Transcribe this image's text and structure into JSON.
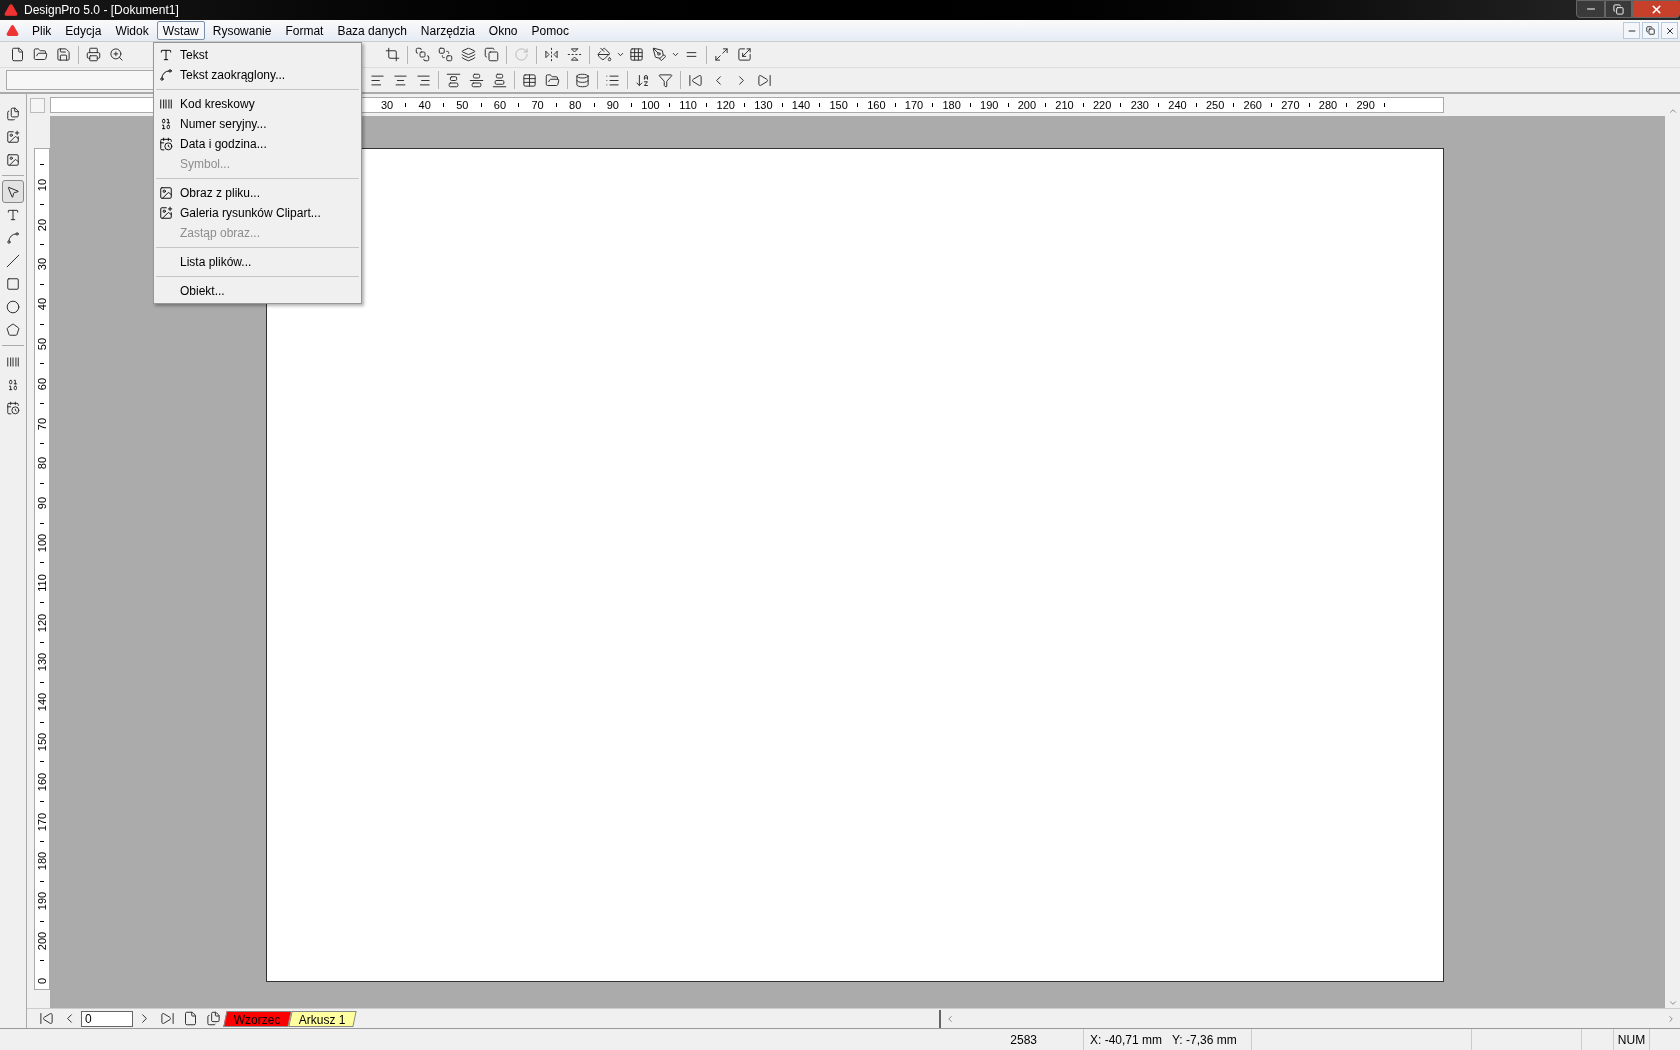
{
  "window": {
    "title": "DesignPro 5.0 - [Dokument1]"
  },
  "menu_bar": [
    {
      "label": "Plik",
      "selected": false
    },
    {
      "label": "Edycja",
      "selected": false
    },
    {
      "label": "Widok",
      "selected": false
    },
    {
      "label": "Wstaw",
      "selected": true
    },
    {
      "label": "Rysowanie",
      "selected": false
    },
    {
      "label": "Format",
      "selected": false
    },
    {
      "label": "Baza danych",
      "selected": false
    },
    {
      "label": "Narzędzia",
      "selected": false
    },
    {
      "label": "Okno",
      "selected": false
    },
    {
      "label": "Pomoc",
      "selected": false
    }
  ],
  "insert_menu": [
    {
      "kind": "text",
      "label": "Tekst",
      "disabled": false
    },
    {
      "kind": "curved",
      "label": "Tekst zaokrąglony...",
      "disabled": false
    },
    {
      "kind": "separator"
    },
    {
      "kind": "barcode",
      "label": "Kod kreskowy",
      "disabled": false
    },
    {
      "kind": "serial",
      "label": "Numer seryjny...",
      "disabled": false
    },
    {
      "kind": "datetime",
      "label": "Data i godzina...",
      "disabled": false
    },
    {
      "kind": "plain",
      "label": "Symbol...",
      "disabled": true
    },
    {
      "kind": "separator"
    },
    {
      "kind": "image",
      "label": "Obraz z pliku...",
      "disabled": false
    },
    {
      "kind": "clipart",
      "label": "Galeria rysunków Clipart...",
      "disabled": false
    },
    {
      "kind": "plain",
      "label": "Zastąp obraz...",
      "disabled": true
    },
    {
      "kind": "separator"
    },
    {
      "kind": "plain",
      "label": "Lista plików...",
      "disabled": false
    },
    {
      "kind": "separator"
    },
    {
      "kind": "plain",
      "label": "Obiekt...",
      "disabled": false
    }
  ],
  "left_tools": [
    {
      "kind": "pages",
      "selected": false
    },
    {
      "kind": "clipart",
      "selected": false
    },
    {
      "kind": "image",
      "selected": false
    },
    {
      "kind": "separator"
    },
    {
      "kind": "pointer",
      "selected": true
    },
    {
      "kind": "text",
      "selected": false
    },
    {
      "kind": "curved",
      "selected": false
    },
    {
      "kind": "line",
      "selected": false
    },
    {
      "kind": "rect",
      "selected": false
    },
    {
      "kind": "ellipse",
      "selected": false
    },
    {
      "kind": "polygon",
      "selected": false
    },
    {
      "kind": "separator"
    },
    {
      "kind": "barcode",
      "selected": false
    },
    {
      "kind": "serial",
      "selected": false
    },
    {
      "kind": "datetime",
      "selected": false
    }
  ],
  "ruler_h": [
    "30",
    "40",
    "50",
    "60",
    "70",
    "80",
    "90",
    "100",
    "110",
    "120",
    "130",
    "140",
    "150",
    "160",
    "170",
    "180",
    "190",
    "200",
    "210",
    "220",
    "230",
    "240",
    "250",
    "260",
    "270",
    "280",
    "290"
  ],
  "ruler_v": [
    "10",
    "20",
    "30",
    "40",
    "50",
    "60",
    "70",
    "80",
    "90",
    "100",
    "110",
    "120",
    "130",
    "140",
    "150",
    "160",
    "170",
    "180",
    "190",
    "200",
    "0"
  ],
  "sheet_nav": {
    "page": "0"
  },
  "sheet_tabs": [
    {
      "label": "Wzorzec",
      "color": "#ff0000"
    },
    {
      "label": "Arkusz 1",
      "color": "#ffffa0"
    }
  ],
  "status_bar": {
    "count": "2583",
    "x": "X: -40,71 mm",
    "y": "Y: -7,36 mm",
    "num": "NUM"
  }
}
